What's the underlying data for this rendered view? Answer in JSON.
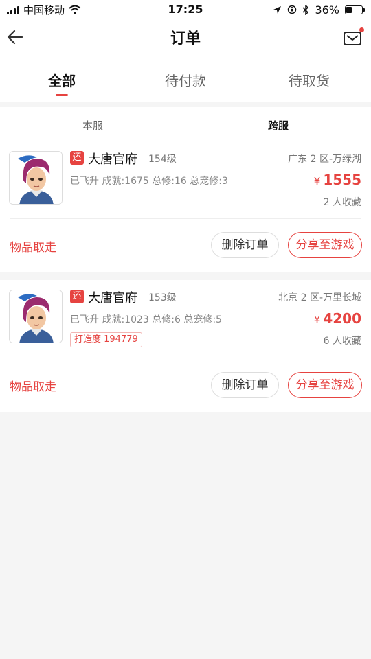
{
  "status_bar": {
    "carrier": "中国移动",
    "time": "17:25",
    "battery_percent": "36%",
    "battery_level": 0.36
  },
  "header": {
    "title": "订单"
  },
  "tabs": [
    {
      "label": "全部",
      "active": true
    },
    {
      "label": "待付款",
      "active": false
    },
    {
      "label": "待取货",
      "active": false
    }
  ],
  "subtabs": [
    {
      "label": "本服",
      "active": false
    },
    {
      "label": "跨服",
      "active": true
    }
  ],
  "orders": [
    {
      "badge": "还",
      "name": "大唐官府",
      "level": "154级",
      "server": "广东 2 区-万绿湖",
      "stats": "已飞升 成就:1675 总修:16 总宠修:3",
      "currency": "¥",
      "price": "1555",
      "favorites": "2 人收藏",
      "status": "物品取走",
      "delete_label": "删除订单",
      "share_label": "分享至游戏"
    },
    {
      "badge": "还",
      "name": "大唐官府",
      "level": "153级",
      "server": "北京 2 区-万里长城",
      "stats": "已飞升 成就:1023 总修:6 总宠修:5",
      "forge_tag": "打造度 194779",
      "currency": "¥",
      "price": "4200",
      "favorites": "6 人收藏",
      "status": "物品取走",
      "delete_label": "删除订单",
      "share_label": "分享至游戏"
    }
  ],
  "colors": {
    "accent": "#e64340",
    "background": "#f5f5f5"
  },
  "icons": {
    "back": "back-arrow-icon",
    "mail": "mail-icon"
  }
}
